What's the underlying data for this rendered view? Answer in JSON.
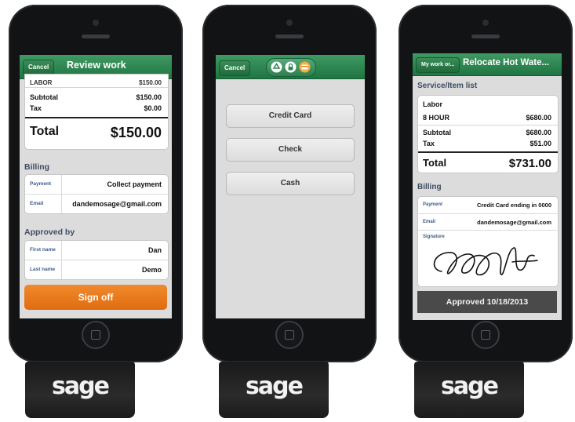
{
  "phone1": {
    "cancel_label": "Cancel",
    "title": "Review work",
    "cut_row": {
      "label": "LABOR",
      "value": "$150.00"
    },
    "subtotal": {
      "label": "Subtotal",
      "value": "$150.00"
    },
    "tax": {
      "label": "Tax",
      "value": "$0.00"
    },
    "total": {
      "label": "Total",
      "value": "$150.00"
    },
    "billing_heading": "Billing",
    "billing": [
      {
        "key": "Payment",
        "value": "Collect payment"
      },
      {
        "key": "Email",
        "value": "dandemosage@gmail.com"
      }
    ],
    "approved_heading": "Approved by",
    "approved": [
      {
        "key": "First name",
        "value": "Dan"
      },
      {
        "key": "Last name",
        "value": "Demo"
      }
    ],
    "signoff_label": "Sign off"
  },
  "phone2": {
    "cancel_label": "Cancel",
    "icons": [
      "recycle-icon",
      "lock-icon",
      "card-icon"
    ],
    "options": [
      "Credit Card",
      "Check",
      "Cash"
    ]
  },
  "phone3": {
    "back_label": "My work or...",
    "title": "Relocate Hot Wate...",
    "service_heading": "Service/Item list",
    "labor_label": "Labor",
    "item": {
      "label": "8 HOUR",
      "value": "$680.00"
    },
    "subtotal": {
      "label": "Subtotal",
      "value": "$680.00"
    },
    "tax": {
      "label": "Tax",
      "value": "$51.00"
    },
    "total": {
      "label": "Total",
      "value": "$731.00"
    },
    "billing_heading": "Billing",
    "billing": [
      {
        "key": "Payment",
        "value": "Credit Card ending in 0000"
      },
      {
        "key": "Email",
        "value": "dandemosage@gmail.com"
      }
    ],
    "signature_label": "Signature",
    "approved_bar": "Approved 10/18/2013"
  },
  "brand": {
    "dongle_text": "sage",
    "accent": "#1f7542",
    "signoff_color": "#e8781a"
  }
}
